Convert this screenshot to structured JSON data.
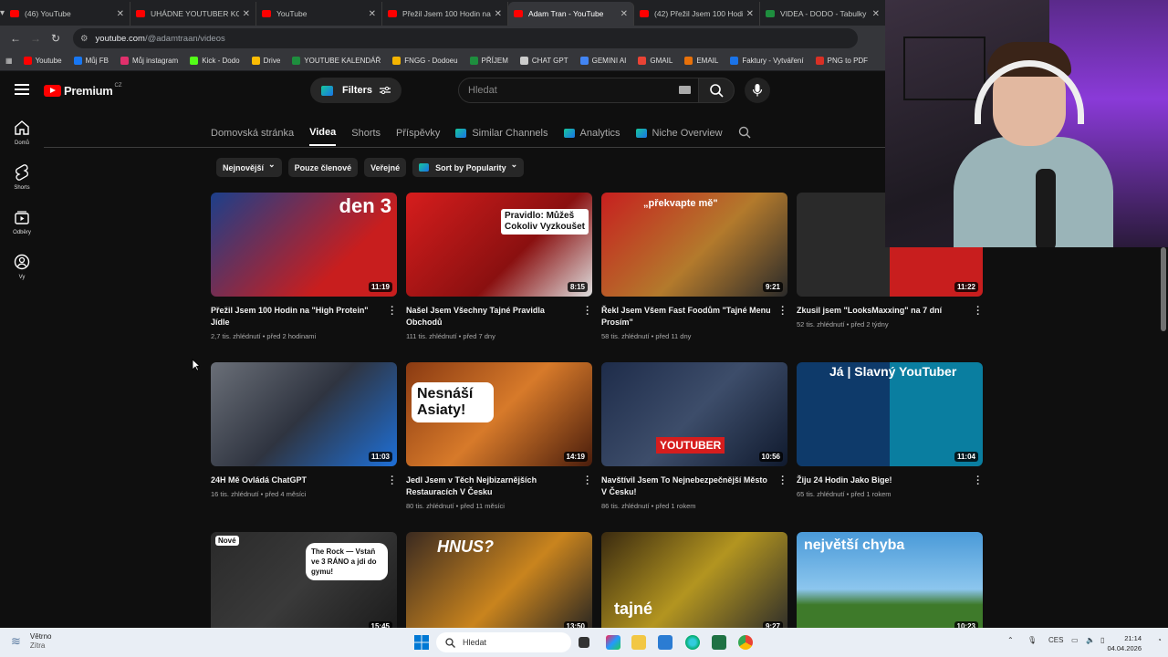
{
  "browser": {
    "tabs": [
      {
        "title": "(46) YouTube",
        "active": false
      },
      {
        "title": "UHÁDNE YOUTUBER KOL",
        "active": false
      },
      {
        "title": "YouTube",
        "active": false
      },
      {
        "title": "Přežil Jsem 100 Hodin na",
        "active": false
      },
      {
        "title": "Adam Tran - YouTube",
        "active": true
      },
      {
        "title": "(42) Přežil Jsem 100 Hodin",
        "active": false
      },
      {
        "title": "VIDEA - DODO - Tabulky",
        "active": false
      }
    ],
    "url_host": "youtube.com",
    "url_path": "/@adamtraan/videos",
    "bookmarks": [
      {
        "label": "Youtube",
        "color": "#ff0000"
      },
      {
        "label": "Můj FB",
        "color": "#1877f2"
      },
      {
        "label": "Můj instagram",
        "color": "#e1306c"
      },
      {
        "label": "Kick - Dodo",
        "color": "#53fc18"
      },
      {
        "label": "Drive",
        "color": "#fbbc04"
      },
      {
        "label": "YOUTUBE KALENDÁŘ",
        "color": "#1e8e3e"
      },
      {
        "label": "FNGG - Dodoeu",
        "color": "#f4b400"
      },
      {
        "label": "PŘÍJEM",
        "color": "#1e8e3e"
      },
      {
        "label": "CHAT GPT",
        "color": "#cccccc"
      },
      {
        "label": "GEMINI AI",
        "color": "#4285f4"
      },
      {
        "label": "GMAIL",
        "color": "#ea4335"
      },
      {
        "label": "EMAIL",
        "color": "#e8710a"
      },
      {
        "label": "Faktury - Vytváření",
        "color": "#1a73e8"
      },
      {
        "label": "PNG to PDF",
        "color": "#d93025"
      }
    ]
  },
  "youtube": {
    "logo": "Premium",
    "logo_region": "CZ",
    "filters_label": "Filters",
    "search_placeholder": "Hledat",
    "sidebar": [
      {
        "label": "Domů",
        "icon": "home-icon"
      },
      {
        "label": "Shorts",
        "icon": "shorts-icon"
      },
      {
        "label": "Odběry",
        "icon": "subscriptions-icon"
      },
      {
        "label": "Vy",
        "icon": "you-icon"
      }
    ],
    "channel_tabs": [
      {
        "label": "Domovská stránka",
        "active": false,
        "ext": false
      },
      {
        "label": "Videa",
        "active": true,
        "ext": false
      },
      {
        "label": "Shorts",
        "active": false,
        "ext": false
      },
      {
        "label": "Příspěvky",
        "active": false,
        "ext": false
      },
      {
        "label": "Similar Channels",
        "active": false,
        "ext": true
      },
      {
        "label": "Analytics",
        "active": false,
        "ext": true
      },
      {
        "label": "Niche Overview",
        "active": false,
        "ext": true
      }
    ],
    "chips": [
      {
        "label": "Nejnovější",
        "dropdown": true,
        "ext": false
      },
      {
        "label": "Pouze členové",
        "dropdown": false,
        "ext": false
      },
      {
        "label": "Veřejné",
        "dropdown": false,
        "ext": false
      },
      {
        "label": "Sort by Popularity",
        "dropdown": true,
        "ext": true
      }
    ],
    "videos": [
      {
        "title": "Přežil Jsem 100 Hodin na \"High Protein\" Jídle",
        "meta": "2,7 tis. zhlédnutí • před 2 hodinami",
        "duration": "11:19",
        "overlay": "den 3",
        "bg": "linear-gradient(135deg,#1c3f8a,#c81e1e 70%)"
      },
      {
        "title": "Našel Jsem Všechny Tajné Pravidla Obchodů",
        "meta": "111 tis. zhlédnutí • před 7 dny",
        "duration": "8:15",
        "overlay": "Pravidlo: Můžeš Cokoliv Vyzkoušet",
        "bg": "linear-gradient(135deg,#d61d1d,#8a1010 60%,#ddd)"
      },
      {
        "title": "Řekl Jsem Všem Fast Foodům \"Tajné Menu Prosím\"",
        "meta": "58 tis. zhlédnutí • před 11 dny",
        "duration": "9:21",
        "overlay": "„překvapte mě\"",
        "bg": "linear-gradient(135deg,#c71f1f,#b37a2c 55%,#2a2a2a)"
      },
      {
        "title": "Zkusil jsem \"LooksMaxxing\" na 7 dní",
        "meta": "52 tis. zhlédnutí • před 2 týdny",
        "duration": "11:22",
        "overlay": "",
        "bg": "linear-gradient(90deg,#2a2a2a 50%,#c81e1e 50%)"
      },
      {
        "title": "24H Mě Ovládá ChatGPT",
        "meta": "16 tis. zhlédnutí • před 4 měsíci",
        "duration": "11:03",
        "overlay": "",
        "bg": "linear-gradient(135deg,#6a6f78,#2f3440 50%,#1e6fd6)"
      },
      {
        "title": "Jedl Jsem v Těch Nejbizarnějších Restauracích V Česku",
        "meta": "80 tis. zhlédnutí • před 11 měsíci",
        "duration": "14:19",
        "overlay": "Nesnáší Asiaty!",
        "bg": "linear-gradient(135deg,#8a3a12,#d77a2a 50%,#4a1d0c)"
      },
      {
        "title": "Navštívil Jsem To Nejnebezpečnější Město V Česku!",
        "meta": "86 tis. zhlédnutí • před 1 rokem",
        "duration": "10:56",
        "overlay": "YOUTUBER",
        "bg": "linear-gradient(135deg,#1e2c4a,#3d4d6a 50%,#101a2e)"
      },
      {
        "title": "Žiju 24 Hodin Jako Bige!",
        "meta": "65 tis. zhlédnutí • před 1 rokem",
        "duration": "11:04",
        "overlay": "Já | Slavný YouTuber",
        "bg": "linear-gradient(90deg,#0e3a6a 50%,#0a7ea0 50%)"
      },
      {
        "title": "",
        "meta": "",
        "duration": "15:45",
        "overlay": "The Rock — Vstaň ve 3 RÁNO a jdi do gymu!",
        "badge": "Nové",
        "bg": "linear-gradient(135deg,#2a2a2a,#3a3a3a 50%,#1a1a1a)"
      },
      {
        "title": "",
        "meta": "",
        "duration": "13:50",
        "overlay": "HNUS?",
        "bg": "linear-gradient(135deg,#3a2a20,#c9841e 55%,#222)"
      },
      {
        "title": "",
        "meta": "",
        "duration": "9:27",
        "overlay": "tajné",
        "bg": "linear-gradient(135deg,#3a2a10,#b39520 50%,#2a2a2a)"
      },
      {
        "title": "",
        "meta": "",
        "duration": "10:23",
        "overlay": "největší chyba",
        "bg": "linear-gradient(180deg,#4a9ad8 0%,#8cc6ee 55%,#3e7a2a 70%)"
      }
    ]
  },
  "taskbar": {
    "weather_label": "Větrno",
    "weather_sub": "Zítra",
    "search_placeholder": "Hledat",
    "lang": "CES",
    "time": "21:14",
    "date": "04.04.2026"
  }
}
